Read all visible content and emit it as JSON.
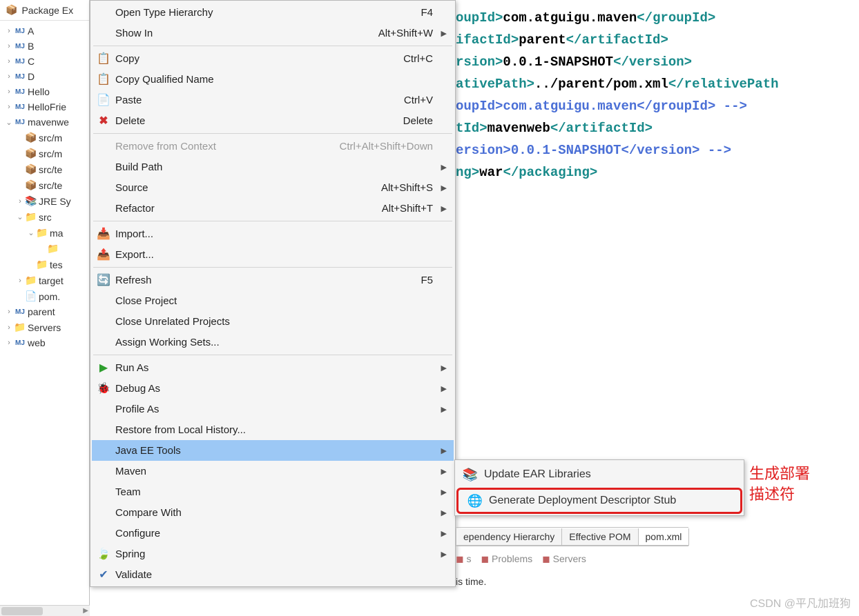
{
  "explorer": {
    "title": "Package Ex",
    "items": [
      {
        "indent": 0,
        "tw": "›",
        "icon": "mj",
        "label": "A"
      },
      {
        "indent": 0,
        "tw": "›",
        "icon": "mj",
        "label": "B"
      },
      {
        "indent": 0,
        "tw": "›",
        "icon": "mj",
        "label": "C"
      },
      {
        "indent": 0,
        "tw": "›",
        "icon": "mj",
        "label": "D"
      },
      {
        "indent": 0,
        "tw": "›",
        "icon": "mj",
        "label": "Hello"
      },
      {
        "indent": 0,
        "tw": "›",
        "icon": "mj",
        "label": "HelloFrie"
      },
      {
        "indent": 0,
        "tw": "⌄",
        "icon": "mj",
        "label": "mavenwe"
      },
      {
        "indent": 1,
        "tw": "",
        "icon": "pkg",
        "label": "src/m"
      },
      {
        "indent": 1,
        "tw": "",
        "icon": "pkg",
        "label": "src/m"
      },
      {
        "indent": 1,
        "tw": "",
        "icon": "pkg",
        "label": "src/te"
      },
      {
        "indent": 1,
        "tw": "",
        "icon": "pkg",
        "label": "src/te"
      },
      {
        "indent": 1,
        "tw": "›",
        "icon": "jar",
        "label": "JRE Sy"
      },
      {
        "indent": 1,
        "tw": "⌄",
        "icon": "folder",
        "label": "src"
      },
      {
        "indent": 2,
        "tw": "⌄",
        "icon": "folder",
        "label": "ma"
      },
      {
        "indent": 3,
        "tw": "",
        "icon": "folder",
        "label": ""
      },
      {
        "indent": 2,
        "tw": "",
        "icon": "folder",
        "label": "tes"
      },
      {
        "indent": 1,
        "tw": "›",
        "icon": "folder",
        "label": "target"
      },
      {
        "indent": 1,
        "tw": "",
        "icon": "xml",
        "label": "pom."
      },
      {
        "indent": 0,
        "tw": "›",
        "icon": "mj",
        "label": "parent"
      },
      {
        "indent": 0,
        "tw": "›",
        "icon": "folder",
        "label": "Servers"
      },
      {
        "indent": 0,
        "tw": "›",
        "icon": "mj",
        "label": "web"
      }
    ]
  },
  "code": {
    "lines": [
      {
        "cls": "",
        "parts": [
          {
            "t": "tag",
            "s": "oupId>"
          },
          {
            "t": "txt",
            "s": "com.atguigu.maven"
          },
          {
            "t": "tag",
            "s": "</groupId>"
          }
        ]
      },
      {
        "cls": "",
        "parts": [
          {
            "t": "tag",
            "s": "ifactId>"
          },
          {
            "t": "txt",
            "s": "parent"
          },
          {
            "t": "tag",
            "s": "</artifactId>"
          }
        ]
      },
      {
        "cls": "",
        "parts": [
          {
            "t": "tag",
            "s": "rsion>"
          },
          {
            "t": "txt",
            "s": "0.0.1-SNAPSHOT"
          },
          {
            "t": "tag",
            "s": "</version>"
          }
        ]
      },
      {
        "cls": "",
        "parts": [
          {
            "t": "tag",
            "s": "ativePath>"
          },
          {
            "t": "txt",
            "s": "../parent/pom.xml"
          },
          {
            "t": "tag",
            "s": "</relativePath"
          }
        ]
      },
      {
        "cls": "",
        "parts": [
          {
            "t": "tag",
            "s": ""
          }
        ]
      },
      {
        "cls": "",
        "parts": [
          {
            "t": "txt",
            "s": ""
          }
        ]
      },
      {
        "cls": "",
        "parts": [
          {
            "t": "cmt",
            "s": "oupId>com.atguigu.maven</groupId> -->"
          }
        ]
      },
      {
        "cls": "",
        "parts": [
          {
            "t": "tag",
            "s": "tId>"
          },
          {
            "t": "txt",
            "s": "mavenweb"
          },
          {
            "t": "tag",
            "s": "</artifactId>"
          }
        ]
      },
      {
        "cls": "",
        "parts": [
          {
            "t": "cmt",
            "s": "ersion>0.0.1-SNAPSHOT</version> -->"
          }
        ]
      },
      {
        "cls": "",
        "parts": [
          {
            "t": "txt",
            "s": ""
          }
        ]
      },
      {
        "cls": "",
        "parts": [
          {
            "t": "txt",
            "s": ""
          }
        ]
      },
      {
        "cls": "",
        "parts": [
          {
            "t": "tag",
            "s": "ng>"
          },
          {
            "t": "txt",
            "s": "war"
          },
          {
            "t": "tag",
            "s": "</packaging>"
          }
        ]
      },
      {
        "cls": "",
        "parts": [
          {
            "t": "txt",
            "s": ""
          }
        ]
      },
      {
        "cls": "hl",
        "parts": [
          {
            "t": "txt",
            "s": ""
          }
        ]
      }
    ]
  },
  "menu": {
    "items": [
      {
        "type": "item",
        "icon": "",
        "label": "Open Type Hierarchy",
        "accel": "F4",
        "arrow": false,
        "disabled": false
      },
      {
        "type": "item",
        "icon": "",
        "label": "Show In",
        "accel": "Alt+Shift+W",
        "arrow": true,
        "disabled": false
      },
      {
        "type": "sep"
      },
      {
        "type": "item",
        "icon": "copy",
        "label": "Copy",
        "accel": "Ctrl+C",
        "arrow": false,
        "disabled": false,
        "iconGlyph": "📋"
      },
      {
        "type": "item",
        "icon": "copyq",
        "label": "Copy Qualified Name",
        "accel": "",
        "arrow": false,
        "disabled": false,
        "iconGlyph": "📋"
      },
      {
        "type": "item",
        "icon": "paste",
        "label": "Paste",
        "accel": "Ctrl+V",
        "arrow": false,
        "disabled": false,
        "iconGlyph": "📄"
      },
      {
        "type": "item",
        "icon": "delete",
        "label": "Delete",
        "accel": "Delete",
        "arrow": false,
        "disabled": false,
        "iconGlyph": "✖"
      },
      {
        "type": "sep"
      },
      {
        "type": "item",
        "icon": "",
        "label": "Remove from Context",
        "accel": "Ctrl+Alt+Shift+Down",
        "arrow": false,
        "disabled": true
      },
      {
        "type": "item",
        "icon": "",
        "label": "Build Path",
        "accel": "",
        "arrow": true,
        "disabled": false
      },
      {
        "type": "item",
        "icon": "",
        "label": "Source",
        "accel": "Alt+Shift+S",
        "arrow": true,
        "disabled": false
      },
      {
        "type": "item",
        "icon": "",
        "label": "Refactor",
        "accel": "Alt+Shift+T",
        "arrow": true,
        "disabled": false
      },
      {
        "type": "sep"
      },
      {
        "type": "item",
        "icon": "import",
        "label": "Import...",
        "accel": "",
        "arrow": false,
        "disabled": false,
        "iconGlyph": "📥"
      },
      {
        "type": "item",
        "icon": "export",
        "label": "Export...",
        "accel": "",
        "arrow": false,
        "disabled": false,
        "iconGlyph": "📤"
      },
      {
        "type": "sep"
      },
      {
        "type": "item",
        "icon": "refresh",
        "label": "Refresh",
        "accel": "F5",
        "arrow": false,
        "disabled": false,
        "iconGlyph": "🔄"
      },
      {
        "type": "item",
        "icon": "",
        "label": "Close Project",
        "accel": "",
        "arrow": false,
        "disabled": false
      },
      {
        "type": "item",
        "icon": "",
        "label": "Close Unrelated Projects",
        "accel": "",
        "arrow": false,
        "disabled": false
      },
      {
        "type": "item",
        "icon": "",
        "label": "Assign Working Sets...",
        "accel": "",
        "arrow": false,
        "disabled": false
      },
      {
        "type": "sep"
      },
      {
        "type": "item",
        "icon": "run",
        "label": "Run As",
        "accel": "",
        "arrow": true,
        "disabled": false,
        "iconGlyph": "▶"
      },
      {
        "type": "item",
        "icon": "debug",
        "label": "Debug As",
        "accel": "",
        "arrow": true,
        "disabled": false,
        "iconGlyph": "🐞"
      },
      {
        "type": "item",
        "icon": "",
        "label": "Profile As",
        "accel": "",
        "arrow": true,
        "disabled": false
      },
      {
        "type": "item",
        "icon": "",
        "label": "Restore from Local History...",
        "accel": "",
        "arrow": false,
        "disabled": false
      },
      {
        "type": "item",
        "icon": "",
        "label": "Java EE Tools",
        "accel": "",
        "arrow": true,
        "disabled": false,
        "hov": true
      },
      {
        "type": "item",
        "icon": "",
        "label": "Maven",
        "accel": "",
        "arrow": true,
        "disabled": false
      },
      {
        "type": "item",
        "icon": "",
        "label": "Team",
        "accel": "",
        "arrow": true,
        "disabled": false
      },
      {
        "type": "item",
        "icon": "",
        "label": "Compare With",
        "accel": "",
        "arrow": true,
        "disabled": false
      },
      {
        "type": "item",
        "icon": "",
        "label": "Configure",
        "accel": "",
        "arrow": true,
        "disabled": false
      },
      {
        "type": "item",
        "icon": "spring",
        "label": "Spring",
        "accel": "",
        "arrow": true,
        "disabled": false,
        "iconGlyph": "🍃"
      },
      {
        "type": "item",
        "icon": "validate",
        "label": "Validate",
        "accel": "",
        "arrow": false,
        "disabled": false,
        "iconGlyph": "✔"
      }
    ]
  },
  "submenu": {
    "items": [
      {
        "icon": "📚",
        "label": "Update EAR Libraries",
        "hl": false
      },
      {
        "icon": "🌐",
        "label": "Generate Deployment Descriptor Stub",
        "hl": true
      }
    ]
  },
  "annotation": {
    "line1": "生成部署",
    "line2": "描述符"
  },
  "bottom_tabs": {
    "tabs": [
      {
        "label": "ependency Hierarchy",
        "active": false
      },
      {
        "label": "Effective POM",
        "active": false
      },
      {
        "label": "pom.xml",
        "active": true
      }
    ]
  },
  "bottom_panel": {
    "tabs": [
      "s",
      "Problems",
      "Servers"
    ],
    "msg": "is time."
  },
  "watermark": "CSDN @平凡加班狗"
}
